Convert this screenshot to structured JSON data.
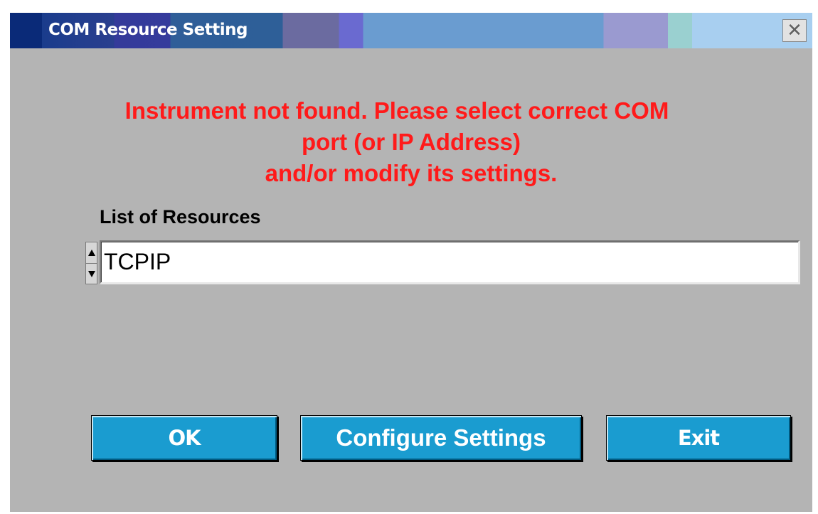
{
  "window": {
    "title": "COM Resource Setting",
    "close_glyph": "✕"
  },
  "message": {
    "line1": "Instrument not found. Please select correct COM",
    "line2": "port (or IP Address)",
    "line3": "and/or modify its settings.",
    "color": "#ff1a1a"
  },
  "resources": {
    "label": "List of Resources",
    "selected": "TCPIP"
  },
  "buttons": {
    "ok": "OK",
    "configure": "Configure Settings",
    "exit": "Exit",
    "color": "#1a9cd0"
  },
  "icons": {
    "close": "close-icon",
    "spin_up": "arrow-up-icon",
    "spin_down": "arrow-down-icon"
  }
}
